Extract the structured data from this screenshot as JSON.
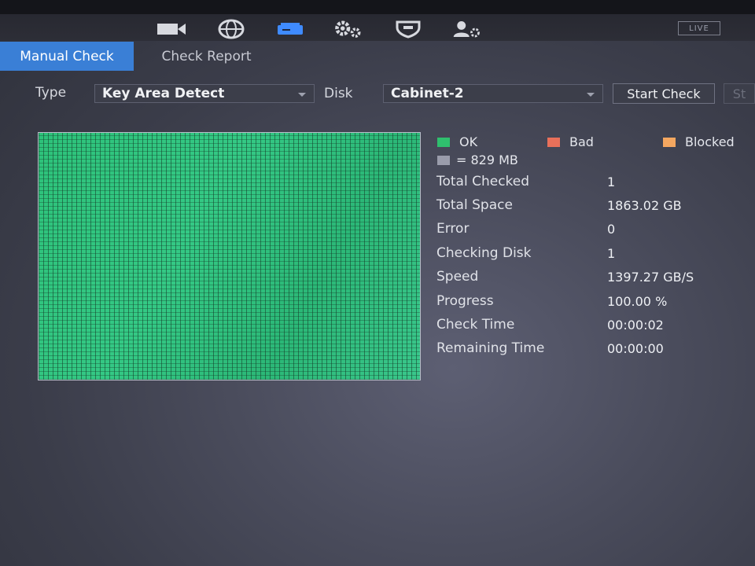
{
  "top_nav": {
    "icons": [
      "camera-icon",
      "network-globe-icon",
      "storage-disk-icon",
      "system-gears-icon",
      "security-shield-icon",
      "account-user-icon"
    ],
    "live_label": "LIVE"
  },
  "tabs": [
    {
      "label": "Manual Check",
      "active": true
    },
    {
      "label": "Check Report",
      "active": false
    }
  ],
  "filters": {
    "type_label": "Type",
    "type_value": "Key Area Detect",
    "disk_label": "Disk",
    "disk_value": "Cabinet-2",
    "start_check_label": "Start Check",
    "next_button_label": "St"
  },
  "legend": {
    "ok": "OK",
    "bad": "Bad",
    "blocked": "Blocked",
    "block_size": "= 829 MB",
    "colors": {
      "ok": "#2fbf6e",
      "bad": "#e8705a",
      "blocked": "#f4a760",
      "unit": "#9a9cab"
    }
  },
  "stats": [
    {
      "label": "Total Checked",
      "value": "1"
    },
    {
      "label": "Total Space",
      "value": "1863.02 GB"
    },
    {
      "label": "Error",
      "value": "0"
    },
    {
      "label": "Checking Disk",
      "value": "1"
    },
    {
      "label": "Speed",
      "value": "1397.27 GB/S"
    },
    {
      "label": "Progress",
      "value": "100.00 %"
    },
    {
      "label": "Check Time",
      "value": "00:00:02"
    },
    {
      "label": "Remaining Time",
      "value": "00:00:00"
    }
  ]
}
